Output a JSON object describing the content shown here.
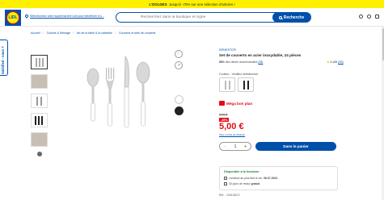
{
  "promo": {
    "bold": "L'DOLDES",
    "text": " : Jusqu'à -70% sur une sélection d'articles !"
  },
  "header": {
    "logo_text": "LIDL",
    "store_text": "Sélectionnez votre supermarché Lidl pour bénéficier d'u...",
    "search_placeholder": "Recherchez dans la boutique en ligne",
    "search_button": "Recherche"
  },
  "breadcrumb": [
    "Accueil",
    "Cuisine & Ménage",
    "Art de la table & la vaisselle",
    "Couverts et sets de couverts"
  ],
  "side_tab": "Satisfied - vous ?",
  "product": {
    "brand": "ERNESTO®",
    "title": "Set de couverts en acier inoxydable, 24 pièces",
    "reco_pct": "85%",
    "reco_text": "des clients recommandent",
    "reco_link": "(28)",
    "rating": "4.4/5",
    "rating_count": "(28)",
    "color_label": "Couleur :",
    "color_value": "Veuillez sélectionner",
    "offer": "Méga bon plan",
    "old_price": "9,99 €",
    "discount": "-49%",
    "price": "5,00 €",
    "price_note": "Taxe et frais de livraison",
    "qty": "1",
    "add_cart": "Dans le panier"
  },
  "availability": {
    "head": "Disponible à la livraison",
    "line1_a": "Livraison au plus tard le lun. ",
    "line1_b": "08.07.2024",
    "line2_a": "30 jours de retour ",
    "line2_b": "gratuit",
    "ref": "Réf. : 100133217"
  },
  "colors": {
    "lidl_blue": "#0050aa",
    "lidl_red": "#e60a14",
    "lidl_yellow": "#fff000"
  }
}
